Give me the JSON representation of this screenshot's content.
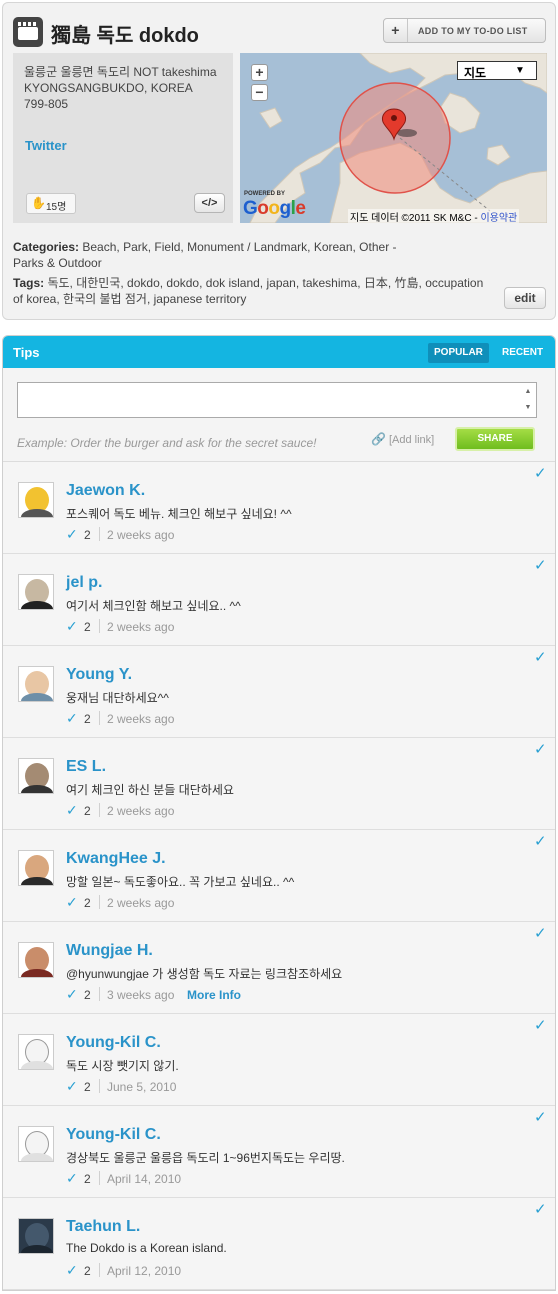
{
  "venue": {
    "title": "獨島 독도 dokdo",
    "todo_button": "ADD TO MY TO-DO LIST",
    "address": [
      "울릉군 울릉면 독도리 NOT takeshima",
      "KYONGSANGBUKDO, KOREA",
      "799-805"
    ],
    "twitter": "Twitter",
    "likes": "15명",
    "embed_label": "</>",
    "categories_label": "Categories:",
    "categories": "Beach, Park, Field, Monument / Landmark, Korean, Other - Parks & Outdoor",
    "tags_label": "Tags:",
    "tags": "독도, 대한민국, dokdo, dokdo, dok island, japan, takeshima, 日本, 竹島, occupation of korea, 한국의 불법 점거, japanese territory",
    "edit_label": "edit"
  },
  "map": {
    "type_select": "지도",
    "zoom_in": "+",
    "zoom_out": "−",
    "powered_by": "POWERED BY",
    "google_letters": [
      "G",
      "o",
      "o",
      "g",
      "l",
      "e"
    ],
    "credit": "지도 데이터 ©2011 SK M&C - ",
    "terms": "이용약관",
    "colors": {
      "water": "#a6bfd6",
      "land": "#e9e4da",
      "circle": "#f08a7c",
      "pin": "#e33a2c"
    }
  },
  "tips": {
    "title": "Tips",
    "tab_popular": "POPULAR",
    "tab_recent": "RECENT",
    "input_value": "",
    "example": "Example: Order the burger and ask for the secret sauce!",
    "add_link": "[Add link]",
    "share": "SHARE",
    "items": [
      {
        "user": "Jaewon K.",
        "text": "포스퀘어 독도 베뉴. 체크인 해보구 싶네요! ^^",
        "count": "2",
        "date": "2 weeks ago",
        "more": ""
      },
      {
        "user": "jel p.",
        "text": "여기서 체크인함 해보고 싶네요.. ^^",
        "count": "2",
        "date": "2 weeks ago",
        "more": ""
      },
      {
        "user": "Young Y.",
        "text": "웅재님 대단하세요^^",
        "count": "2",
        "date": "2 weeks ago",
        "more": ""
      },
      {
        "user": "ES L.",
        "text": "여기 체크인 하신 분들 대단하세요",
        "count": "2",
        "date": "2 weeks ago",
        "more": ""
      },
      {
        "user": "KwangHee J.",
        "text": "망할 일본~ 독도좋아요.. 꼭 가보고 싶네요.. ^^",
        "count": "2",
        "date": "2 weeks ago",
        "more": ""
      },
      {
        "user": "Wungjae H.",
        "text": "@hyunwungjae 가 생성함 독도 자료는 링크참조하세요",
        "count": "2",
        "date": "3 weeks ago",
        "more": "More Info"
      },
      {
        "user": "Young-Kil C.",
        "text": "독도 시장 뺏기지 않기.",
        "count": "2",
        "date": "June 5, 2010",
        "more": ""
      },
      {
        "user": "Young-Kil C.",
        "text": "경상북도 울릉군 울릉읍 독도리 1~96번지독도는 우리땅.",
        "count": "2",
        "date": "April 14, 2010",
        "more": ""
      },
      {
        "user": "Taehun L.",
        "text": "The Dokdo is a Korean island.",
        "count": "2",
        "date": "April 12, 2010",
        "more": ""
      }
    ]
  }
}
